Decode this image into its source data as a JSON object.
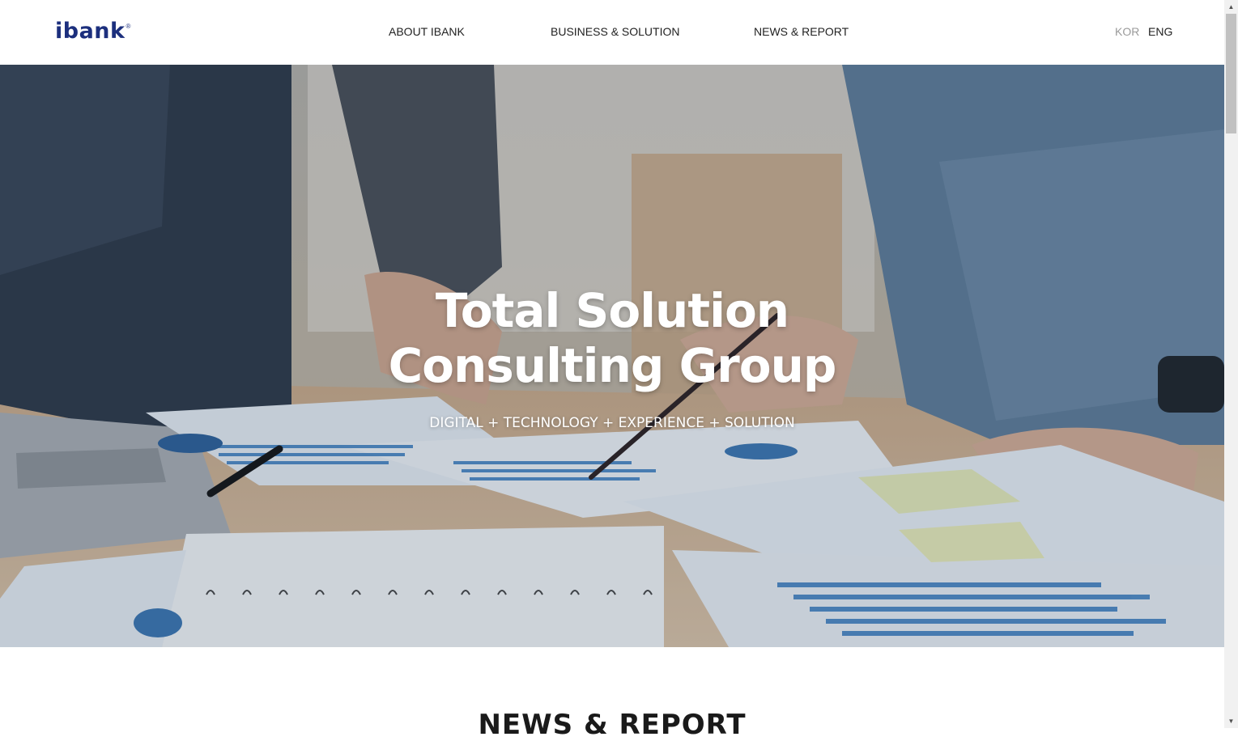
{
  "header": {
    "logo_text": "ibank",
    "logo_mark": "®",
    "nav": {
      "about": "ABOUT IBANK",
      "business": "BUSINESS & SOLUTION",
      "news": "NEWS & REPORT"
    },
    "lang": {
      "kor": "KOR",
      "eng": "ENG"
    }
  },
  "hero": {
    "title_line1": "Total Solution",
    "title_line2": "Consulting Group",
    "subtitle": "DIGITAL + TECHNOLOGY + EXPERIENCE + SOLUTION"
  },
  "news_section": {
    "heading": "NEWS & REPORT"
  },
  "colors": {
    "brand": "#1c2f7d",
    "lang_inactive": "#9a9a9a"
  }
}
